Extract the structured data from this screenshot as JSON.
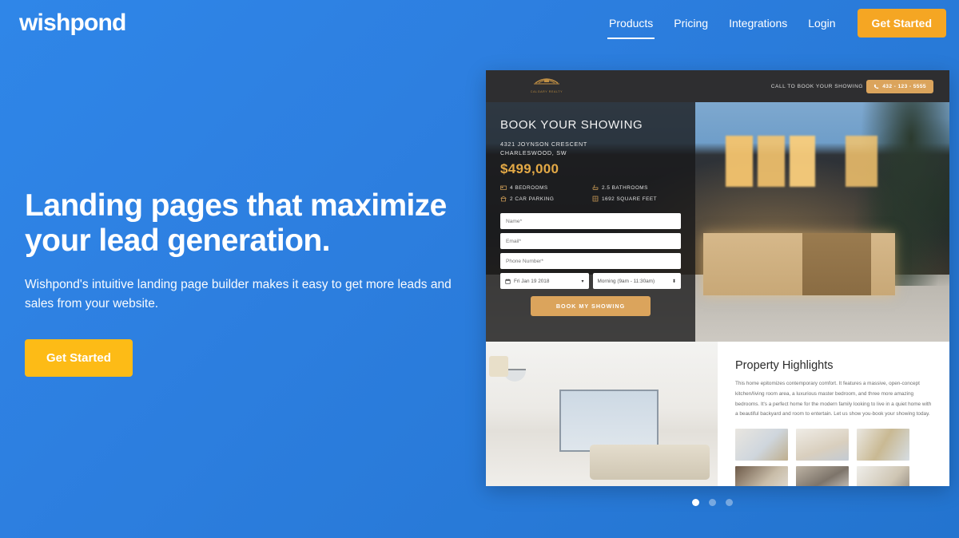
{
  "site": {
    "logo_text": "wishpond",
    "background_color": "#2a7ade"
  },
  "nav": {
    "items": [
      {
        "label": "Products",
        "active": true
      },
      {
        "label": "Pricing",
        "active": false
      },
      {
        "label": "Integrations",
        "active": false
      },
      {
        "label": "Login",
        "active": false
      }
    ],
    "cta_label": "Get Started",
    "cta_color": "#f5a623"
  },
  "hero": {
    "title": "Landing pages that maximize your lead generation.",
    "subtitle": "Wishpond's intuitive landing page builder makes it easy to get more leads and sales from your website.",
    "cta_label": "Get Started",
    "cta_color": "#fdbb16"
  },
  "mockup": {
    "topbar": {
      "brand_name": "CALGARY REALTY",
      "call_label": "CALL TO BOOK YOUR SHOWING",
      "phone_number": "432 - 123 - 5555",
      "accent_color": "#dba45c"
    },
    "hero_panel": {
      "heading": "BOOK YOUR SHOWING",
      "address_line1": "4321 JOYNSON CRESCENT",
      "address_line2": "CHARLESWOOD, SW",
      "price": "$499,000",
      "price_color": "#e3a946",
      "features": [
        {
          "icon": "bed-icon",
          "label": "4 BEDROOMS"
        },
        {
          "icon": "bath-icon",
          "label": "2.5 BATHROOMS"
        },
        {
          "icon": "garage-icon",
          "label": "2 CAR PARKING"
        },
        {
          "icon": "area-icon",
          "label": "1692 SQUARE FEET"
        }
      ],
      "form": {
        "name_placeholder": "Name*",
        "email_placeholder": "Email*",
        "phone_placeholder": "Phone Number*",
        "date_value": "Fri Jan 19 2018",
        "time_value": "Morning (9am - 11:30am)",
        "submit_label": "BOOK MY SHOWING"
      }
    },
    "highlights": {
      "title": "Property Highlights",
      "body": "This home epitomizes contemporary comfort. It features a massive, open-concept kitchen/living room area, a luxurious master bedroom, and three more amazing bedrooms. It's a perfect home for the modern family looking to live in a quiet home with a beautiful backyard and room to entertain. Let us show you-book your showing today.",
      "thumbnails": [
        "living-room-thumb",
        "kitchen-thumb",
        "lounge-thumb",
        "bedroom-thumb",
        "bathroom-thumb",
        "dining-thumb"
      ]
    }
  },
  "carousel": {
    "dots": [
      {
        "active": true
      },
      {
        "active": false
      },
      {
        "active": false
      }
    ]
  }
}
